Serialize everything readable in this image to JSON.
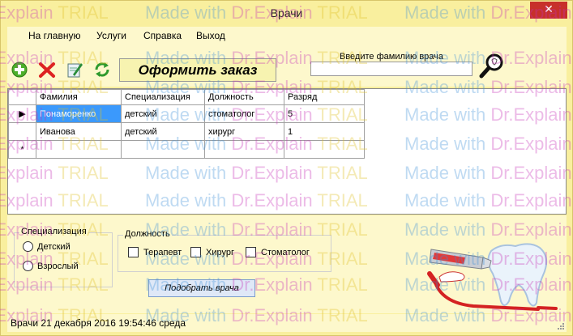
{
  "window": {
    "title": "Врачи",
    "close_glyph": "✕"
  },
  "menu": {
    "items": [
      "На главную",
      "Услуги",
      "Справка",
      "Выход"
    ]
  },
  "toolbar": {
    "icons": [
      "add-icon",
      "delete-icon",
      "edit-icon",
      "refresh-icon"
    ],
    "order_button": "Оформить заказ",
    "search_label": "Введите фамилию врача",
    "search_value": "",
    "search_icon": "magnifier-icon"
  },
  "grid": {
    "columns": [
      "Фамилия",
      "Специализация",
      "Должность",
      "Разряд"
    ],
    "rows": [
      {
        "marker": "▶",
        "cells": [
          "Понаморенко",
          "детский",
          "стоматолог",
          "5"
        ]
      },
      {
        "marker": "",
        "cells": [
          "Иванова",
          "детский",
          "хирург",
          "1"
        ]
      },
      {
        "marker": "*",
        "cells": [
          "",
          "",
          "",
          ""
        ]
      }
    ]
  },
  "filters": {
    "specialization": {
      "title": "Специализация",
      "options": [
        "Детский",
        "Взрослый"
      ]
    },
    "position": {
      "title": "Должность",
      "options": [
        "Терапевт",
        "Хирург",
        "Стоматолог"
      ]
    },
    "pick_button": "Подобрать врача"
  },
  "status": {
    "text": "Врачи  21 декабря 2016 19:54:46 среда"
  },
  "watermark": {
    "parts": [
      "Made with ",
      "Dr.Explain ",
      "TRIAL"
    ],
    "colors": [
      "#3a8fd9",
      "#c62fb7",
      "#e0c020"
    ]
  }
}
